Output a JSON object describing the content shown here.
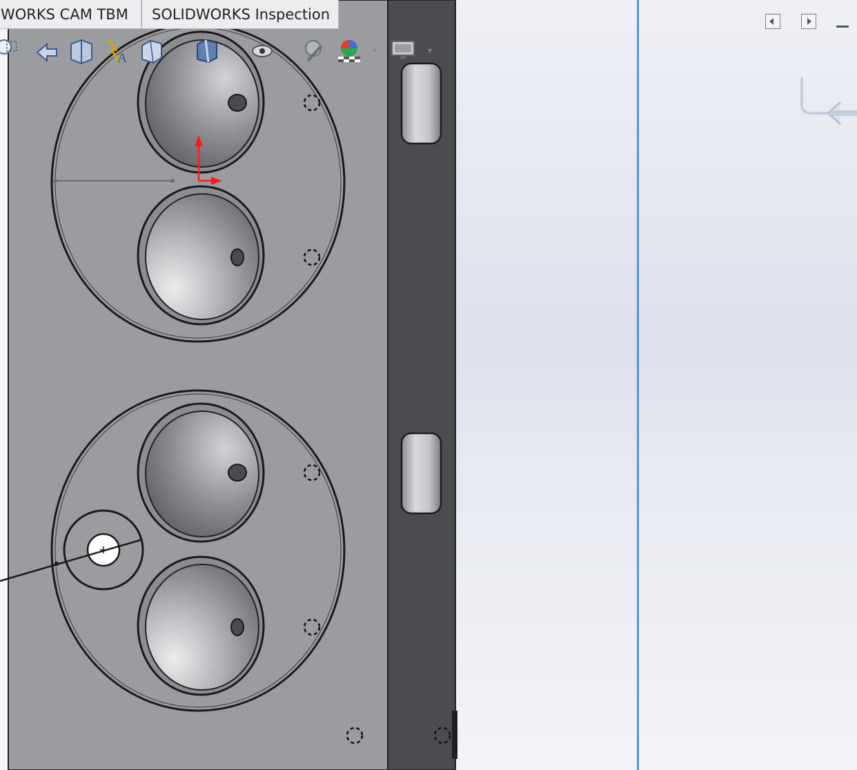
{
  "tabs": [
    {
      "label": "WORKS CAM TBM"
    },
    {
      "label": "SOLIDWORKS Inspection"
    }
  ],
  "heads_up_toolbar": [
    {
      "icon": "zoom-to-area-icon"
    },
    {
      "icon": "previous-view-icon"
    },
    {
      "icon": "section-view-icon"
    },
    {
      "icon": "dynamic-annotation-views-icon"
    },
    {
      "icon": "view-orientation-icon"
    },
    {
      "icon": "display-style-icon"
    },
    {
      "icon": "hide-show-items-icon"
    },
    {
      "icon": "edit-appearance-icon"
    },
    {
      "icon": "apply-scene-icon"
    },
    {
      "icon": "view-settings-icon"
    }
  ],
  "window_controls": [
    {
      "icon": "collapse-left-icon"
    },
    {
      "icon": "expand-right-icon"
    },
    {
      "icon": "minimize-icon"
    }
  ],
  "colors": {
    "part_face": "#9b9c9f",
    "side_face": "#4b4c4f",
    "splitter": "#5b8ef5",
    "triad_axis": "#ff1a1a"
  }
}
